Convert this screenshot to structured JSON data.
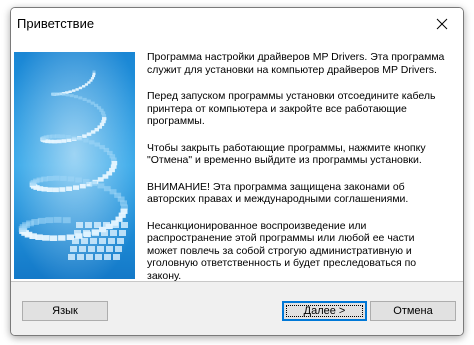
{
  "window": {
    "title": "Приветствие",
    "close_icon": "close-icon"
  },
  "banner": {
    "image": "spiral-cd-graphic",
    "colors": {
      "sky": "#1f8fd8",
      "light": "#cfeeff"
    }
  },
  "message": {
    "p1": "Программа настройки драйверов MP Drivers. Эта программа служит для установки на компьютер драйверов MP Drivers.",
    "p2": "Перед запуском программы установки отсоедините кабель принтера от компьютера и закройте все работающие программы.",
    "p3": "Чтобы закрыть работающие программы, нажмите кнопку \"Отмена\" и временно выйдите из программы установки.",
    "p4": "ВНИМАНИЕ! Эта программа защищена законами об авторских правах и международными соглашениями.",
    "p5": "Несанкционированное воспроизведение или распространение этой программы или любой ее части может повлечь за собой строгую административную и уголовную ответственность и будет преследоваться по закону."
  },
  "buttons": {
    "language": "Язык",
    "next_accel": "Д",
    "next_rest": "алее >",
    "cancel": "Отмена"
  },
  "colors": {
    "accent": "#0078d7",
    "button_face": "#e1e1e1",
    "dialog_bg": "#f0f0f0"
  }
}
